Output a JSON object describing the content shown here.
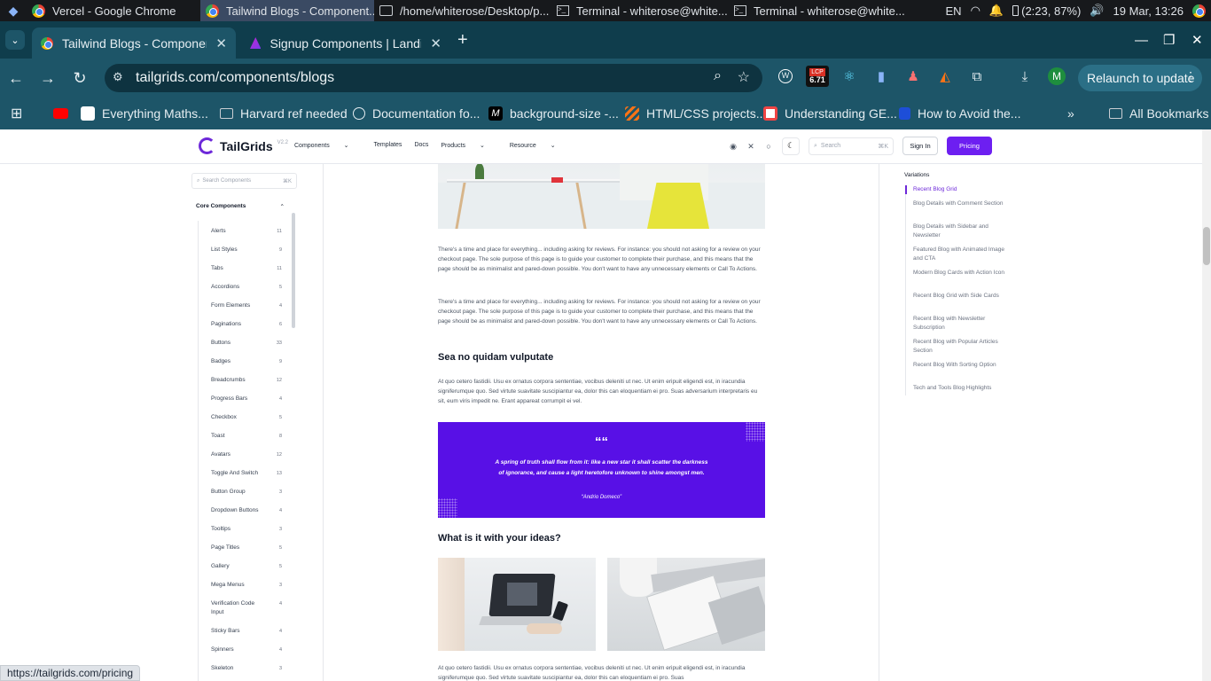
{
  "taskbar": {
    "apps": [
      {
        "label": "Vercel - Google Chrome",
        "icon": "chrome-icon"
      },
      {
        "label": "Tailwind Blogs - Component...",
        "icon": "chrome-icon",
        "active": true
      },
      {
        "label": "/home/whiterose/Desktop/p...",
        "icon": "folder-icon"
      },
      {
        "label": "Terminal - whiterose@white...",
        "icon": "terminal-icon"
      },
      {
        "label": "Terminal - whiterose@white...",
        "icon": "terminal-icon"
      }
    ],
    "lang": "EN",
    "battery": "(2:23, 87%)",
    "datetime": "19 Mar, 13:26"
  },
  "browser": {
    "tabs": [
      {
        "title": "Tailwind Blogs - Components",
        "active": true
      },
      {
        "title": "Signup Components | Landin",
        "active": false
      }
    ],
    "url": "tailgrids.com/components/blogs",
    "lcp_label": "LCP",
    "lcp_value": "6.71",
    "profile_initial": "M",
    "relaunch_label": "Relaunch to update",
    "bookmarks": [
      {
        "label": "Everything Maths..."
      },
      {
        "label": "Harvard ref needed"
      },
      {
        "label": "Documentation fo..."
      },
      {
        "label": "background-size -..."
      },
      {
        "label": "HTML/CSS projects..."
      },
      {
        "label": "Understanding GE..."
      },
      {
        "label": "How to Avoid the..."
      }
    ],
    "all_bookmarks": "All Bookmarks",
    "status_url": "https://tailgrids.com/pricing"
  },
  "site": {
    "logo": "TailGrids",
    "version": "V2.2",
    "nav": [
      "Components",
      "Templates",
      "Docs",
      "Products",
      "Resource"
    ],
    "search_placeholder": "Search",
    "search_kbd": "⌘K",
    "signin": "Sign In",
    "pricing": "Pricing"
  },
  "sidebar": {
    "search_placeholder": "Search Components",
    "search_kbd": "⌘K",
    "section": "Core Components",
    "items": [
      {
        "label": "Alerts",
        "count": "11"
      },
      {
        "label": "List Styles",
        "count": "9"
      },
      {
        "label": "Tabs",
        "count": "11"
      },
      {
        "label": "Accordions",
        "count": "5"
      },
      {
        "label": "Form Elements",
        "count": "4"
      },
      {
        "label": "Paginations",
        "count": "6"
      },
      {
        "label": "Buttons",
        "count": "33"
      },
      {
        "label": "Badges",
        "count": "9"
      },
      {
        "label": "Breadcrumbs",
        "count": "12"
      },
      {
        "label": "Progress Bars",
        "count": "4"
      },
      {
        "label": "Checkbox",
        "count": "5"
      },
      {
        "label": "Toast",
        "count": "8"
      },
      {
        "label": "Avatars",
        "count": "12"
      },
      {
        "label": "Toggle And Switch",
        "count": "13"
      },
      {
        "label": "Button Group",
        "count": "3"
      },
      {
        "label": "Dropdown Buttons",
        "count": "4"
      },
      {
        "label": "Tooltips",
        "count": "3"
      },
      {
        "label": "Page Titles",
        "count": "5"
      },
      {
        "label": "Gallery",
        "count": "5"
      },
      {
        "label": "Mega Menus",
        "count": "3"
      },
      {
        "label": "Verification Code Input",
        "count": "4"
      },
      {
        "label": "Sticky Bars",
        "count": "4"
      },
      {
        "label": "Spinners",
        "count": "4"
      },
      {
        "label": "Skeleton",
        "count": "3"
      }
    ]
  },
  "article": {
    "para1": "There's a time and place for everything... including asking for reviews. For instance: you should not asking for a review on your checkout page. The sole purpose of this page is to guide your customer to complete their purchase, and this means that the page should be as minimalist and pared-down possible. You don't want to have any unnecessary elements or Call To Actions.",
    "para2": "There's a time and place for everything... including asking for reviews. For instance: you should not asking for a review on your checkout page. The sole purpose of this page is to guide your customer to complete their purchase, and this means that the page should be as minimalist and pared-down possible. You don't want to have any unnecessary elements or Call To Actions.",
    "heading1": "Sea no quidam vulputate",
    "para3": "At quo cetero fastidii. Usu ex ornatus corpora sententiae, vocibus deleniti ut nec. Ut enim eripuit eligendi est, in iracundia signiferumque quo. Sed virtute suavitate suscipiantur ea, dolor this can eloquentiam ei pro. Suas adversarium interpretaris eu sit, eum viris impedit ne. Erant appareat corrumpit ei vel.",
    "quote_mark": "““",
    "quote": "A spring of truth shall flow from it: like a new star it shall scatter the darkness of ignorance, and cause a light heretofore unknown to shine amongst men.",
    "quote_author": "“Andrio Domeco”",
    "heading2": "What is it with your ideas?",
    "para4": "At quo cetero fastidii. Usu ex ornatus corpora sententiae, vocibus deleniti ut nec. Ut enim eripuit eligendi est, in iracundia signiferumque quo. Sed virtute suavitate suscipiantur ea, dolor this can eloquentiam ei pro. Suas"
  },
  "toc": {
    "title": "Variations",
    "items": [
      "Recent Blog Grid",
      "Blog Details with Comment Section",
      "Blog Details with Sidebar and Newsletter",
      "Featured Blog with Animated Image and CTA",
      "Modern Blog Cards with Action Icon",
      "Recent Blog Grid with Side Cards",
      "Recent Blog with Newsletter Subscription",
      "Recent Blog with Popular Articles Section",
      "Recent Blog With Sorting Option",
      "Tech and Tools Blog Highlights"
    ]
  },
  "colors": {
    "accent": "#6d1ff1",
    "quote_bg": "#5810e6",
    "chrome_frame": "#1d5568"
  }
}
